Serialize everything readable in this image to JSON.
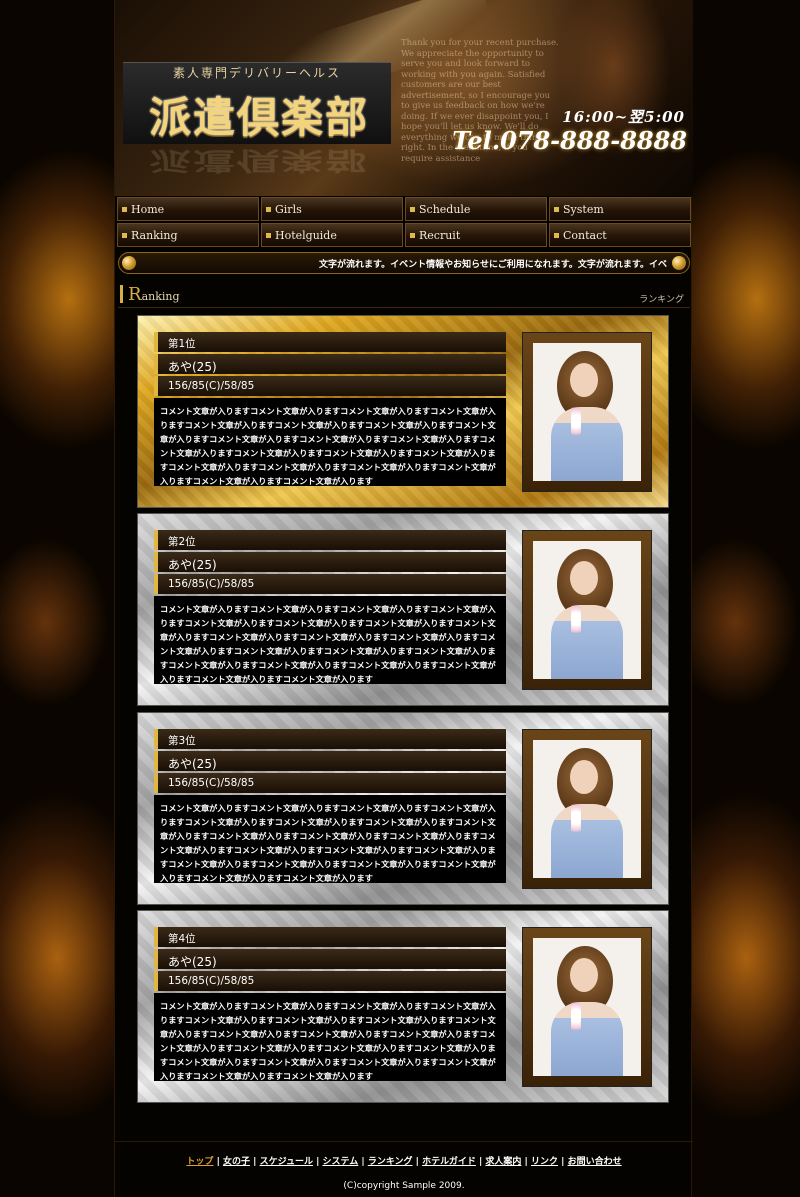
{
  "header": {
    "logo_sub": "素人専門デリバリーヘルス",
    "logo_main": "派遣倶楽部",
    "thanks_text": "Thank you for your recent purchase. We appreciate the opportunity to serve you and look forward to working with you again. Satisfied customers are our best advertisement, so I encourage you to give us feedback on how we're doing. If we ever disappoint you, I hope you'll let us know. We'll do everything we can to make things right. In the meantime, if you require assistance",
    "hours": "16:00~翌5:00",
    "tel": "Tel.078-888-8888"
  },
  "nav": [
    {
      "label": "Home"
    },
    {
      "label": "Girls"
    },
    {
      "label": "Schedule"
    },
    {
      "label": "System"
    },
    {
      "label": "Ranking"
    },
    {
      "label": "Hotelguide"
    },
    {
      "label": "Recruit"
    },
    {
      "label": "Contact"
    }
  ],
  "ticker": {
    "text": "文字が流れます。イベント情報やお知らせにご利用になれます。文字が流れます。イベ"
  },
  "section": {
    "title_initial": "R",
    "title_rest": "anking",
    "title_jp": "ランキング"
  },
  "ranking": [
    {
      "rank": "第1位",
      "name": "あや(25)",
      "size": "156/85(C)/58/85",
      "style": "gold",
      "comment": "コメント文章が入りますコメント文章が入りますコメント文章が入りますコメント文章が入りますコメント文章が入りますコメント文章が入りますコメント文章が入りますコメント文章が入りますコメント文章が入りますコメント文章が入りますコメント文章が入りますコメント文章が入りますコメント文章が入りますコメント文章が入りますコメント文章が入りますコメント文章が入りますコメント文章が入りますコメント文章が入りますコメント文章が入りますコメント文章が入りますコメント文章が入ります"
    },
    {
      "rank": "第2位",
      "name": "あや(25)",
      "size": "156/85(C)/58/85",
      "style": "silver",
      "comment": "コメント文章が入りますコメント文章が入りますコメント文章が入りますコメント文章が入りますコメント文章が入りますコメント文章が入りますコメント文章が入りますコメント文章が入りますコメント文章が入りますコメント文章が入りますコメント文章が入りますコメント文章が入りますコメント文章が入りますコメント文章が入りますコメント文章が入りますコメント文章が入りますコメント文章が入りますコメント文章が入りますコメント文章が入りますコメント文章が入りますコメント文章が入ります"
    },
    {
      "rank": "第3位",
      "name": "あや(25)",
      "size": "156/85(C)/58/85",
      "style": "silver",
      "comment": "コメント文章が入りますコメント文章が入りますコメント文章が入りますコメント文章が入りますコメント文章が入りますコメント文章が入りますコメント文章が入りますコメント文章が入りますコメント文章が入りますコメント文章が入りますコメント文章が入りますコメント文章が入りますコメント文章が入りますコメント文章が入りますコメント文章が入りますコメント文章が入りますコメント文章が入りますコメント文章が入りますコメント文章が入りますコメント文章が入りますコメント文章が入ります"
    },
    {
      "rank": "第4位",
      "name": "あや(25)",
      "size": "156/85(C)/58/85",
      "style": "silver",
      "comment": "コメント文章が入りますコメント文章が入りますコメント文章が入りますコメント文章が入りますコメント文章が入りますコメント文章が入りますコメント文章が入りますコメント文章が入りますコメント文章が入りますコメント文章が入りますコメント文章が入りますコメント文章が入りますコメント文章が入りますコメント文章が入りますコメント文章が入りますコメント文章が入りますコメント文章が入りますコメント文章が入りますコメント文章が入りますコメント文章が入りますコメント文章が入ります"
    }
  ],
  "footer": {
    "links": [
      "トップ",
      "女の子",
      "スケジュール",
      "システム",
      "ランキング",
      "ホテルガイド",
      "求人案内",
      "リンク",
      "お問い合わせ"
    ],
    "copyright": "(C)copyright Sample 2009."
  },
  "colors": {
    "accent_gold": "#d8b040",
    "background": "#000000"
  }
}
